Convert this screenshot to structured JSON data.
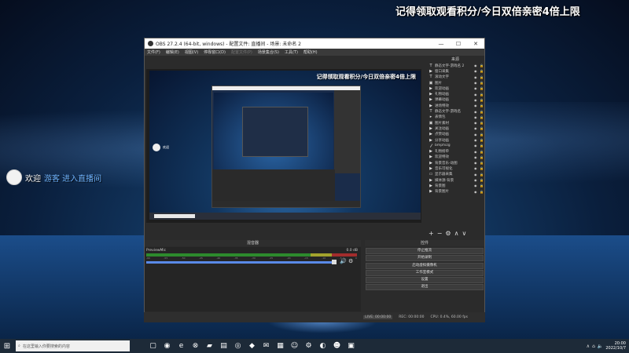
{
  "overlay": {
    "top_right_text": "记得领取观看积分/今日双倍亲密4倍上限",
    "welcome": "欢迎",
    "welcome_name": "游客 进入直播间"
  },
  "obs": {
    "title": "OBS 27.2.4 (64-bit, windows) - 配置文件: 直播间 - 场景: 未命名 2",
    "window_buttons": [
      "—",
      "☐",
      "✕"
    ],
    "menu": [
      "文件(F)",
      "编辑(E)",
      "视图(V)",
      "停靠窗口(D)",
      "配置文件(P)",
      "场景集合(S)",
      "工具(T)",
      "帮助(H)"
    ],
    "menu_disabled_index": 4,
    "preview": {
      "overlay_text": "记得领取观看积分/今日双倍亲密4倍上限",
      "welcome": "欢迎"
    },
    "sources_header": "来源",
    "sources": [
      {
        "icon": "text-icon",
        "glyph": "T",
        "name": "静态文字-游戏名 2",
        "selected": false
      },
      {
        "icon": "play-icon",
        "glyph": "▶",
        "name": "窗口采集",
        "selected": false
      },
      {
        "icon": "text-icon",
        "glyph": "T",
        "name": "滚动文字",
        "selected": false
      },
      {
        "icon": "image-icon",
        "glyph": "▣",
        "name": "图片",
        "selected": false
      },
      {
        "icon": "play-icon",
        "glyph": "▶",
        "name": "欢迎动画",
        "selected": false
      },
      {
        "icon": "play-icon",
        "glyph": "▶",
        "name": "礼物动画",
        "selected": false
      },
      {
        "icon": "play-icon",
        "glyph": "▶",
        "name": "弹幕动画",
        "selected": false
      },
      {
        "icon": "play-icon",
        "glyph": "▶",
        "name": "进场特效",
        "selected": false
      },
      {
        "icon": "text-icon",
        "glyph": "T",
        "name": "静态文字-游戏名",
        "selected": false
      },
      {
        "icon": "folder-icon",
        "glyph": "▸",
        "name": "表情包",
        "selected": false
      },
      {
        "icon": "image-icon",
        "glyph": "▣",
        "name": "图片素材",
        "selected": false
      },
      {
        "icon": "play-icon",
        "glyph": "▶",
        "name": "关注动画",
        "selected": false
      },
      {
        "icon": "play-icon",
        "glyph": "▶",
        "name": "点赞动画",
        "selected": false
      },
      {
        "icon": "play-icon",
        "glyph": "▶",
        "name": "分享动画",
        "selected": false
      },
      {
        "icon": "text-icon",
        "glyph": "𝒻",
        "name": "bmpfxzg",
        "selected": false
      },
      {
        "icon": "play-icon",
        "glyph": "▶",
        "name": "礼物榜单",
        "selected": false
      },
      {
        "icon": "play-icon",
        "glyph": "▶",
        "name": "欢迎特效",
        "selected": false
      },
      {
        "icon": "play-icon",
        "glyph": "▶",
        "name": "背景音乐-动图",
        "selected": false
      },
      {
        "icon": "play-icon",
        "glyph": "▶",
        "name": "音乐可视化",
        "selected": false
      },
      {
        "icon": "monitor-icon",
        "glyph": "▭",
        "name": "显示器采集",
        "selected": false
      },
      {
        "icon": "play-icon",
        "glyph": "▶",
        "name": "媒体源-背景",
        "selected": false
      },
      {
        "icon": "play-icon",
        "glyph": "▶",
        "name": "背景图",
        "selected": false
      },
      {
        "icon": "play-icon",
        "glyph": "▶",
        "name": "背景图片",
        "selected": false
      }
    ],
    "source_tools": [
      "+",
      "−",
      "⚙",
      "∧",
      "∨"
    ],
    "mixer_header": "混音器",
    "mixer_track": "PreviewMic",
    "mixer_db": "0.0 dB",
    "mixer_ticks": [
      "-60",
      "-55",
      "-50",
      "-45",
      "-40",
      "-35",
      "-30",
      "-25",
      "-20",
      "-15",
      "-10",
      "-5",
      "0"
    ],
    "controls_header": "控件",
    "controls": [
      "停止推流",
      "开始录制",
      "启动虚拟摄像机",
      "工作室模式",
      "设置",
      "退出"
    ],
    "status": {
      "live": "LIVE: 00:00:00",
      "rec": "REC: 00:00:00",
      "cpu": "CPU: 0.4%, 60.00 fps"
    }
  },
  "taskbar": {
    "search_placeholder": "在这里输入你要搜索的内容",
    "time": "20:00",
    "date": "2022/10/7",
    "apps": [
      "task-view-icon",
      "obs-icon",
      "edge-icon",
      "xbox-icon",
      "folder-icon",
      "explorer-icon",
      "chrome-icon",
      "game-icon",
      "chat-icon",
      "store-icon",
      "wechat-icon",
      "settings-icon",
      "steam-icon",
      "discord-icon",
      "app-icon"
    ]
  },
  "colors": {
    "obs_bg": "#2b2b2b",
    "selection": "#3d5f8a",
    "meter_green": "#2d8a2d",
    "taskbar": "#1d2a38"
  }
}
